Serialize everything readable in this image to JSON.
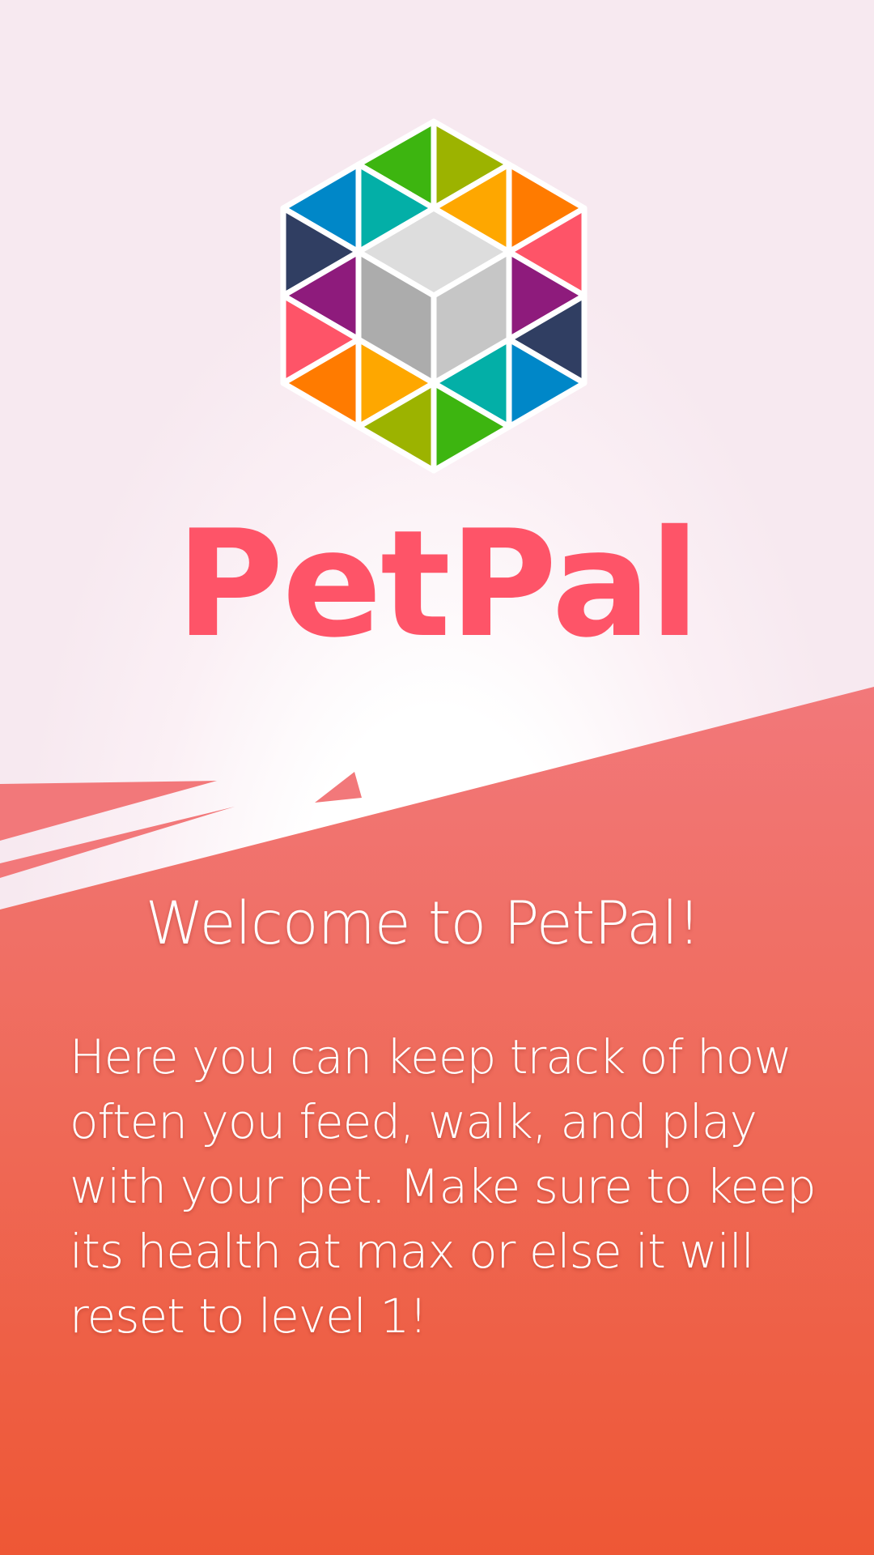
{
  "app": {
    "title": "PetPal",
    "logo_icon": "hexagon-cube-logo-icon"
  },
  "intro": {
    "heading": "Welcome to PetPal!",
    "body": "Here you can keep track of how often you feed, walk, and play with your pet. Make sure to keep its health at max or else it will reset to level 1!"
  },
  "colors": {
    "brand": "#fe5468",
    "panel_top": "#ef7470",
    "panel_bottom": "#ee5735",
    "background": "#ffffff"
  }
}
